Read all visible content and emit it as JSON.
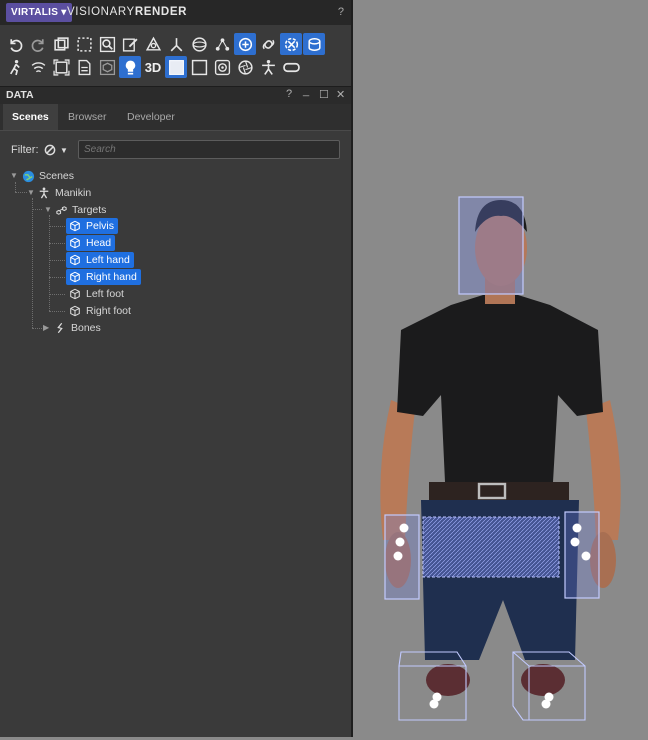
{
  "app": {
    "brand_menu": "VIRTALIS ▾",
    "product_prefix": "VISIONARY",
    "product_suffix": "RENDER",
    "help": "?"
  },
  "toolbar": {
    "row1": [
      "undo-icon",
      "redo-icon",
      "copy-icon",
      "select-box-icon",
      "zoom-fit-icon",
      "edit-icon",
      "transform-icon",
      "axes-icon",
      "sphere-icon",
      "points-icon",
      "rotate-icon",
      "link-icon",
      "collision-icon",
      "layers-icon"
    ],
    "row1_active": [
      10,
      12,
      13
    ],
    "row2": [
      "walk-icon",
      "wireless-icon",
      "screen-icon",
      "file-icon",
      "box-icon",
      "light-icon",
      "3d-toggle",
      "rectangle-fill-icon",
      "rectangle-icon",
      "target-icon",
      "aperture-icon",
      "figure-icon",
      "vr-headset-icon"
    ],
    "row2_active": [
      5,
      7
    ],
    "label_3d": "3D"
  },
  "panel": {
    "title": "DATA",
    "help": "?",
    "minimize": "_",
    "maximize": "☐",
    "close": "✕",
    "tabs": [
      {
        "label": "Scenes",
        "active": true
      },
      {
        "label": "Browser",
        "active": false
      },
      {
        "label": "Developer",
        "active": false
      }
    ],
    "filter_label": "Filter:",
    "search_placeholder": "Search"
  },
  "tree": {
    "scenes": "Scenes",
    "manikin": "Manikin",
    "targets": "Targets",
    "items": [
      {
        "label": "Pelvis",
        "selected": true
      },
      {
        "label": "Head",
        "selected": true
      },
      {
        "label": "Left hand",
        "selected": true
      },
      {
        "label": "Right hand",
        "selected": true
      },
      {
        "label": "Left foot",
        "selected": false
      },
      {
        "label": "Right foot",
        "selected": false
      }
    ],
    "bones": "Bones"
  },
  "colors": {
    "accent": "#2e6fd0",
    "selection": "#1f6fe0",
    "brand": "#5b4fa0",
    "viewport_bg": "#8a8a8a",
    "target_box": "#7f8cff"
  }
}
